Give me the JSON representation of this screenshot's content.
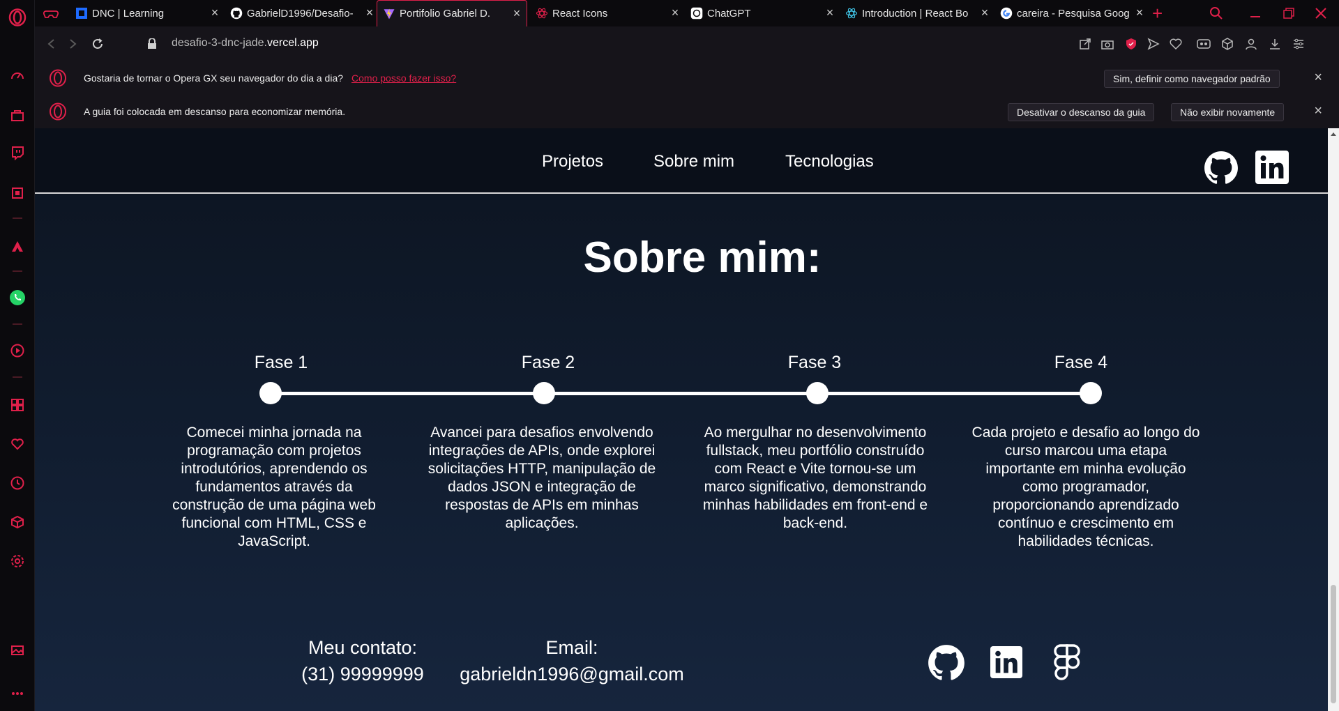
{
  "tabs": [
    {
      "title": "DNC | Learning"
    },
    {
      "title": "GabrielD1996/Desafio-"
    },
    {
      "title": "Portifolio Gabriel D."
    },
    {
      "title": "React Icons"
    },
    {
      "title": "ChatGPT"
    },
    {
      "title": "Introduction | React Bo"
    },
    {
      "title": "careira - Pesquisa Goog"
    }
  ],
  "address": {
    "url_prefix": "desafio-3-dnc-jade.",
    "url_domain": "vercel.app"
  },
  "infobars": [
    {
      "text": "Gostaria de tornar o Opera GX seu navegador do dia a dia?",
      "link": "Como posso fazer isso?",
      "buttons": [
        "Sim, definir como navegador padrão"
      ]
    },
    {
      "text": "A guia foi colocada em descanso para economizar memória.",
      "buttons": [
        "Desativar o descanso da guia",
        "Não exibir novamente"
      ]
    }
  ],
  "site": {
    "nav": [
      "Projetos",
      "Sobre mim",
      "Tecnologias"
    ],
    "section_title": "Sobre mim:",
    "phases": [
      {
        "label": "Fase 1",
        "desc": "Comecei minha jornada na programação com projetos introdutórios, aprendendo os fundamentos através da construção de uma página web funcional com HTML, CSS e JavaScript."
      },
      {
        "label": "Fase 2",
        "desc": "Avancei para desafios envolvendo integrações de APIs, onde explorei solicitações HTTP, manipulação de dados JSON e integração de respostas de APIs em minhas aplicações."
      },
      {
        "label": "Fase 3",
        "desc": "Ao mergulhar no desenvolvimento fullstack, meu portfólio construído com React e Vite tornou-se um marco significativo, demonstrando minhas habilidades em front-end e back-end."
      },
      {
        "label": "Fase 4",
        "desc": "Cada projeto e desafio ao longo do curso marcou uma etapa importante em minha evolução como programador, proporcionando aprendizado contínuo e crescimento em habilidades técnicas."
      }
    ],
    "contact": {
      "phone_label": "Meu contato:",
      "phone": "(31) 99999999",
      "email_label": "Email:",
      "email": "gabrieldn1996@gmail.com"
    }
  },
  "icons": {
    "sidebar": [
      "opera-logo-icon",
      "speed-dial-icon",
      "shopping-bag-icon",
      "twitch-icon",
      "gx-control-icon",
      "aria-icon",
      "whatsapp-icon",
      "player-icon",
      "workspaces-icon",
      "heart-icon",
      "history-icon",
      "cube-icon",
      "settings-icon",
      "gallery-icon",
      "more-icon"
    ]
  },
  "colors": {
    "accent": "#e0204a",
    "page_bg": "#111d30",
    "header_bg": "#0a0f19"
  }
}
